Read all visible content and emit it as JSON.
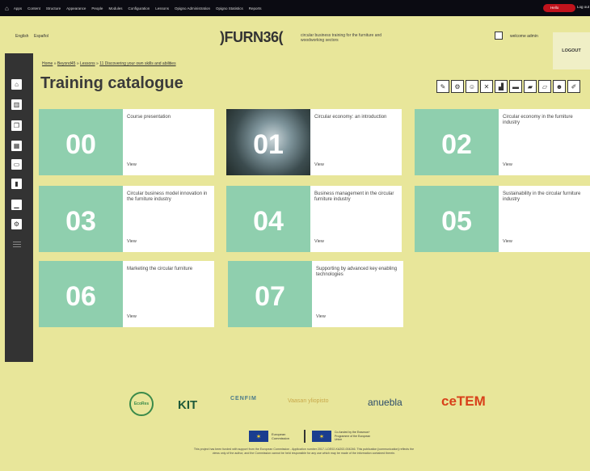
{
  "admin_bar": {
    "items": [
      "Apps",
      "Content",
      "Structure",
      "Appearance",
      "People",
      "Modules",
      "Configuration",
      "Lessons",
      "Opigno Administration",
      "Opigno Statistics",
      "Reports"
    ],
    "user": "Hello",
    "logout": "Log out"
  },
  "header": {
    "lang_en": "English",
    "lang_es": "Español",
    "logo": ")FURN36(",
    "tagline": "circular business training for the furniture and woodworking sectors",
    "welcome": "welcome admin",
    "logout": "LOGOUT"
  },
  "breadcrumb": {
    "home": "Home",
    "beyond": "Beyond45",
    "lessons": "Lessons",
    "current": "11 Discovering your own skills and abilities",
    "sep": " » "
  },
  "page_title": "Training catalogue",
  "sidebar_icons": [
    "home-icon",
    "book-icon",
    "cards-icon",
    "calendar-icon",
    "chat-icon",
    "bookmark-icon",
    "chart-icon",
    "gears-icon"
  ],
  "tool_icons": [
    "edit-icon",
    "settings-icon",
    "user-icon",
    "tools-icon",
    "stats-icon",
    "card-icon",
    "folder-icon",
    "folder-edit-icon",
    "users-icon",
    "pencil-icon"
  ],
  "cards": [
    {
      "number": "00",
      "title": "Course presentation",
      "view": "View"
    },
    {
      "number": "01",
      "title": "Circular economy: an introduction",
      "view": "View"
    },
    {
      "number": "02",
      "title": "Circular economy in the furniture industry",
      "view": "View"
    },
    {
      "number": "03",
      "title": "Circular business model innovation in the furniture industry",
      "view": "View"
    },
    {
      "number": "04",
      "title": "Business management in the circular furniture industry",
      "view": "View"
    },
    {
      "number": "05",
      "title": "Sustainability in the circular furniture industry",
      "view": "View"
    },
    {
      "number": "06",
      "title": "Marketing the circular furniture",
      "view": "View"
    },
    {
      "number": "07",
      "title": "Supporting by advanced key enabling technologies",
      "view": "View"
    }
  ],
  "partners": [
    "EcoRes",
    "KIT",
    "CENFIM",
    "Vaasan yliopisto",
    "anuebla",
    "ceTEM"
  ],
  "eu": {
    "commission": "European Commission",
    "erasmus": "Co-funded by the Erasmus+ Programme of the European Union"
  },
  "disclaimer": "This project has been funded with support from the European Commission - Application number 2017-1-DE02-KA202-004246. This publication [communication] reflects the views only of the author, and the Commission cannot be held responsible for any use which may be made of the information contained therein.",
  "colors": {
    "background": "#e8e69a",
    "card_accent": "#8fcfae",
    "sidebar": "#333333",
    "admin_bar": "#0b0b12"
  }
}
